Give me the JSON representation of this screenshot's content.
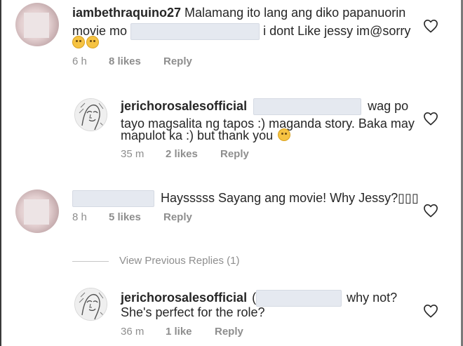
{
  "comments": [
    {
      "username": "iambethraquino27",
      "text_line1": "Malamang ito lang ang diko papanuorin",
      "text_line2_start": "movie mo",
      "text_line2_end": "i dont Like jessy im@sorry",
      "time": "6 h",
      "likes": "8 likes",
      "reply_label": "Reply"
    },
    {
      "username": "jerichorosalesofficial",
      "text_line1_end": "wag po",
      "text_line2": "tayo magsalita ng tapos :) maganda story. Baka may",
      "text_line3": "mapulot ka :) but thank you",
      "time": "35 m",
      "likes": "2 likes",
      "reply_label": "Reply"
    },
    {
      "text": "Haysssss Sayang ang movie! Why Jessy?▯▯▯",
      "time": "8 h",
      "likes": "5 likes",
      "reply_label": "Reply"
    },
    {
      "username": "jerichorosalesofficial",
      "text_line1_start": "(",
      "text_line1_end": "why not?",
      "text_line2": "She's perfect for the role?",
      "time": "36 m",
      "likes": "1 like",
      "reply_label": "Reply"
    }
  ],
  "view_previous_replies": "View Previous Replies (1)",
  "icons": {
    "like": "heart-outline-icon",
    "emoji": "face-emoji-icon"
  }
}
